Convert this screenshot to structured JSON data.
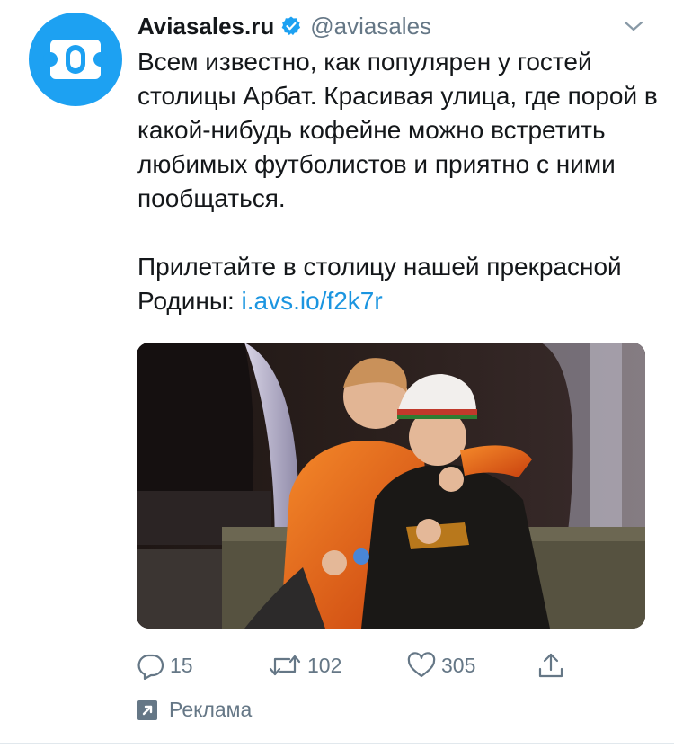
{
  "tweet": {
    "display_name": "Aviasales.ru",
    "handle": "@aviasales",
    "paragraph1": "Всем известно, как популярен у гостей столицы Арбат. Красивая улица, где порой в какой-нибудь кофейне можно встретить любимых футболистов и приятно с ними пообщаться.",
    "paragraph2_text": "Прилетайте в столицу нашей прекрасной Родины:",
    "link": "i.avs.io/f2k7r",
    "icons": {
      "verified": "verified-badge-icon",
      "caret": "chevron-down-icon",
      "reply": "reply-icon",
      "retweet": "retweet-icon",
      "like": "heart-icon",
      "share": "share-icon",
      "promoted": "promoted-arrow-icon"
    }
  },
  "actions": {
    "replies": "15",
    "retweets": "102",
    "likes": "305"
  },
  "promoted_label": "Реклама",
  "colors": {
    "brand_blue": "#1da1f2",
    "link": "#1b95e0",
    "muted": "#657786",
    "text": "#14171a"
  }
}
